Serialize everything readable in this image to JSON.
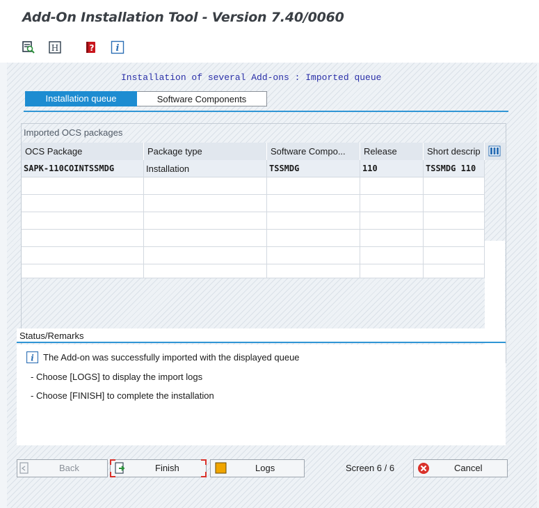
{
  "window": {
    "title": "Add-On Installation Tool - Version 7.40/0060"
  },
  "toolbar": {
    "icons": [
      "overview-icon",
      "header-icon",
      "help-book-icon",
      "info-icon"
    ]
  },
  "headline": "Installation of several Add-ons : Imported queue",
  "tabs": [
    {
      "label": "Installation queue",
      "active": true
    },
    {
      "label": "Software Components",
      "active": false
    }
  ],
  "grid": {
    "caption": "Imported OCS packages",
    "columns": [
      "OCS Package",
      "Package type",
      "Software Compo...",
      "Release",
      "Short descrip"
    ],
    "rows": [
      [
        "SAPK-110COINTSSMDG",
        "Installation",
        "TSSMDG",
        "110",
        "TSSMDG 110"
      ]
    ]
  },
  "status": {
    "title": "Status/Remarks",
    "message": "The Add-on was successfully imported with the displayed queue",
    "line1": "- Choose [LOGS] to display the import logs",
    "line2": "- Choose [FINISH] to complete the installation"
  },
  "buttons": {
    "back": "Back",
    "finish": "Finish",
    "logs": "Logs",
    "cancel": "Cancel"
  },
  "screen_indicator": "Screen 6 / 6",
  "colors": {
    "accent": "#1d8cd1",
    "headline": "#2a2fa8",
    "cancel": "#d9312a",
    "logs": "#f0a500"
  }
}
